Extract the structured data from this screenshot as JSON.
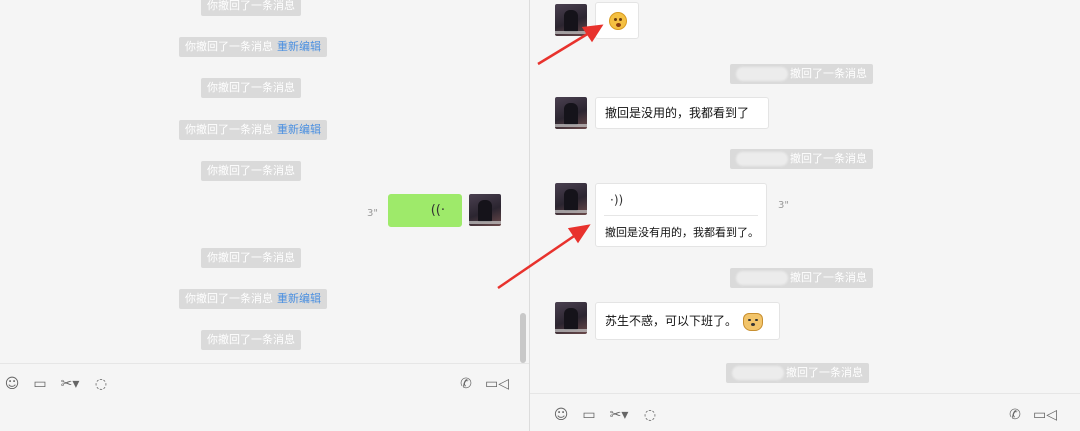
{
  "left": {
    "messages": [
      {
        "text": "你撤回了一条消息",
        "reedit": ""
      },
      {
        "text": "你撤回了一条消息",
        "reedit": "重新编辑"
      },
      {
        "text": "你撤回了一条消息",
        "reedit": ""
      },
      {
        "text": "你撤回了一条消息",
        "reedit": "重新编辑"
      },
      {
        "text": "你撤回了一条消息",
        "reedit": ""
      },
      {
        "text": "你撤回了一条消息",
        "reedit": ""
      },
      {
        "text": "你撤回了一条消息",
        "reedit": "重新编辑"
      },
      {
        "text": "你撤回了一条消息",
        "reedit": ""
      }
    ],
    "voice": {
      "duration": "3\"",
      "icon": "voice-wave-icon"
    }
  },
  "right": {
    "recall_notice": "撤回了一条消息",
    "messages": {
      "m1": "撤回是没用的，我都看到了",
      "voice_duration": "3\"",
      "voice_transcript": "撤回是没有用的，我都看到了。",
      "m3": "苏生不惑，可以下班了。"
    }
  },
  "toolbar": {
    "icons": [
      "emoji-icon",
      "folder-icon",
      "scissors-icon",
      "chat-history-icon"
    ],
    "call_icons": [
      "phone-icon",
      "video-call-icon"
    ]
  },
  "colors": {
    "accent_link": "#4a8fe0",
    "sent_bubble": "#9eea6a",
    "annotation_arrow": "#e8322d"
  }
}
